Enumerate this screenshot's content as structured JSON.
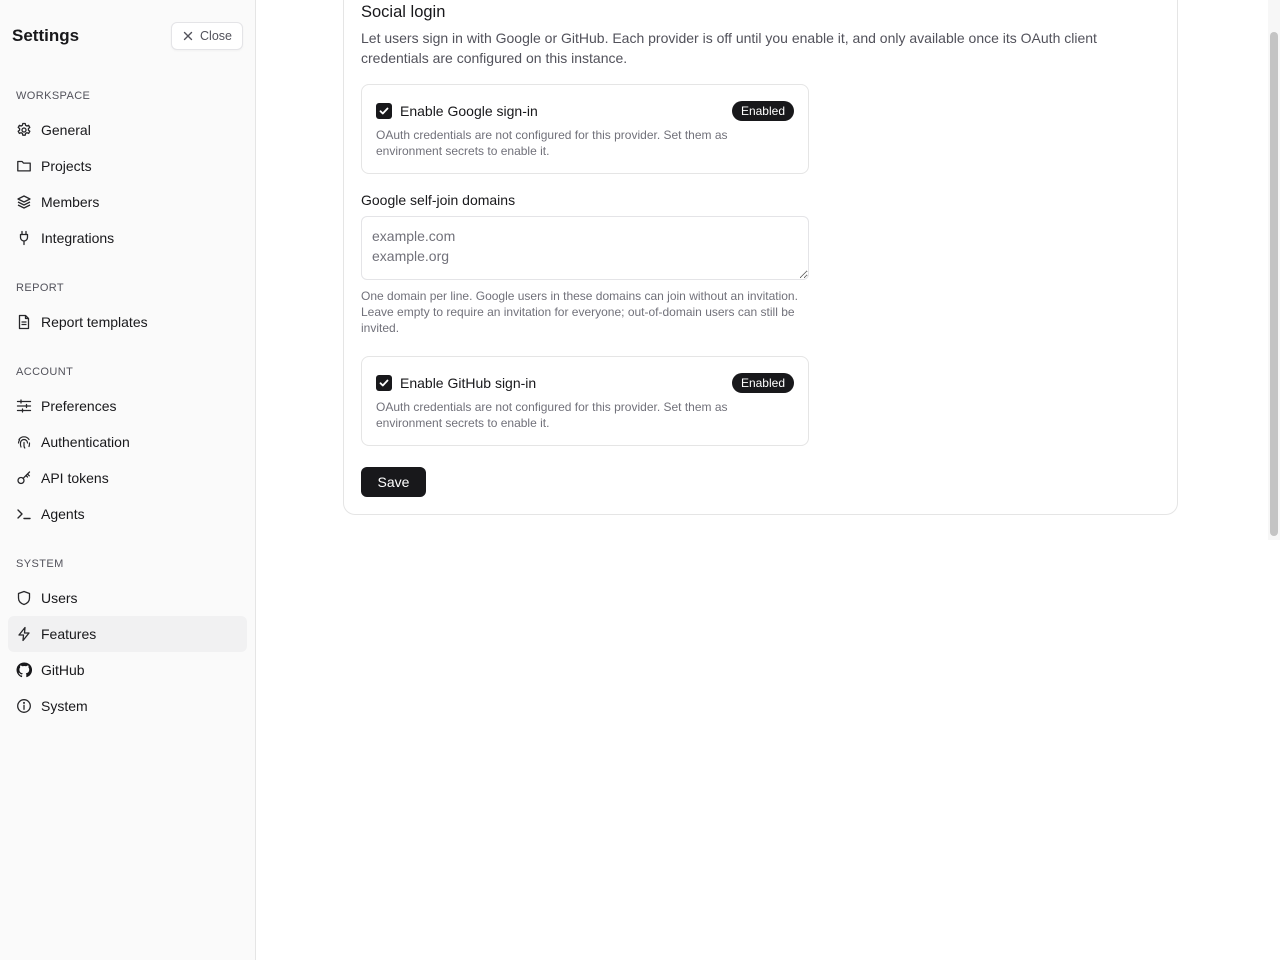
{
  "sidebar": {
    "title": "Settings",
    "close_label": "Close",
    "sections": {
      "workspace": {
        "title": "WORKSPACE",
        "items": [
          {
            "label": "General",
            "icon": "gear-icon"
          },
          {
            "label": "Projects",
            "icon": "folder-icon"
          },
          {
            "label": "Members",
            "icon": "layers-icon"
          },
          {
            "label": "Integrations",
            "icon": "plug-icon"
          }
        ]
      },
      "report": {
        "title": "REPORT",
        "items": [
          {
            "label": "Report templates",
            "icon": "document-icon"
          }
        ]
      },
      "account": {
        "title": "ACCOUNT",
        "items": [
          {
            "label": "Preferences",
            "icon": "sliders-icon"
          },
          {
            "label": "Authentication",
            "icon": "fingerprint-icon"
          },
          {
            "label": "API tokens",
            "icon": "key-icon"
          },
          {
            "label": "Agents",
            "icon": "terminal-icon"
          }
        ]
      },
      "system": {
        "title": "SYSTEM",
        "items": [
          {
            "label": "Users",
            "icon": "shield-icon"
          },
          {
            "label": "Features",
            "icon": "lightning-icon",
            "active": true
          },
          {
            "label": "GitHub",
            "icon": "github-icon"
          },
          {
            "label": "System",
            "icon": "info-icon"
          }
        ]
      }
    }
  },
  "main": {
    "section_title": "Social login",
    "section_description": "Let users sign in with Google or GitHub. Each provider is off until you enable it, and only available once its OAuth client credentials are configured on this instance.",
    "google": {
      "label": "Enable Google sign-in",
      "checked": true,
      "badge": "Enabled",
      "note": "OAuth credentials are not configured for this provider. Set them as environment secrets to enable it."
    },
    "domains": {
      "label": "Google self-join domains",
      "value": "",
      "placeholder": "example.com\nexample.org",
      "help": "One domain per line. Google users in these domains can join without an invitation. Leave empty to require an invitation for everyone; out-of-domain users can still be invited."
    },
    "github": {
      "label": "Enable GitHub sign-in",
      "checked": true,
      "badge": "Enabled",
      "note": "OAuth credentials are not configured for this provider. Set them as environment secrets to enable it."
    },
    "save_label": "Save"
  }
}
